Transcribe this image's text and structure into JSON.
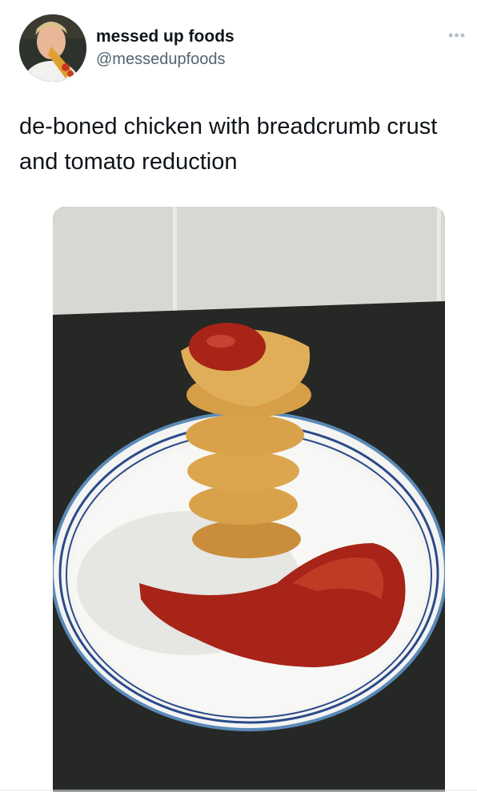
{
  "tweet": {
    "display_name": "messed up foods",
    "handle": "@messedupfoods",
    "text": "de-boned chicken with breadcrumb crust and tomato reduction",
    "more_icon": "more-dots-icon"
  },
  "photo": {
    "subject": "stacked nuggets with ketchup on a white plate"
  },
  "colors": {
    "text_primary": "#0f1419",
    "text_secondary": "#536471",
    "nugget": "#d9a24a",
    "ketchup": "#a82418",
    "plate_rim": "#2c4a8a"
  }
}
